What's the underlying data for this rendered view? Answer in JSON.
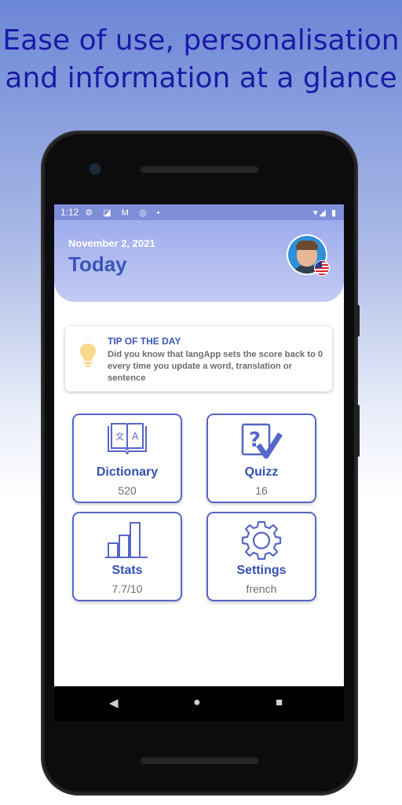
{
  "headline": {
    "line1": "Ease of use, personalisation",
    "line2": "and information at a glance"
  },
  "status_bar": {
    "time": "1:12",
    "left_icons": "⚙ ◪ M ◎ •",
    "right_icons": "▾◢ ▮"
  },
  "header": {
    "date": "November 2, 2021",
    "title": "Today",
    "avatar_icon": "user-avatar",
    "flag_icon": "us-flag-icon"
  },
  "tip": {
    "title": "TIP OF THE DAY",
    "text": "Did you know that langApp sets the score back to 0 every time you update a word, translation or sentence",
    "icon": "lightbulb-icon"
  },
  "cards": {
    "dictionary": {
      "label": "Dictionary",
      "value": "520",
      "icon": "dictionary-icon"
    },
    "quizz": {
      "label": "Quizz",
      "value": "16",
      "icon": "quiz-icon"
    },
    "stats": {
      "label": "Stats",
      "value": "7.7/10",
      "icon": "bar-chart-icon"
    },
    "settings": {
      "label": "Settings",
      "value": "french",
      "icon": "gear-icon"
    }
  },
  "nav": {
    "back": "◀",
    "home": "●",
    "recents": "■"
  },
  "colors": {
    "accent": "#3b55b8",
    "card_border": "#5666c8",
    "header_bg": "#a9b5ee",
    "status_bar": "#7e8ed8",
    "bulb": "#fbd98a",
    "headline": "#1a1aa6"
  }
}
